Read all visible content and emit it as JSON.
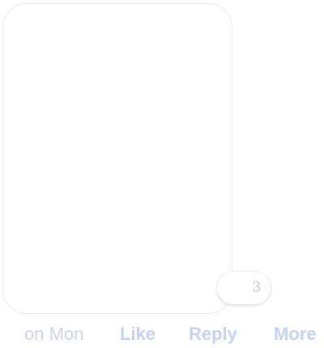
{
  "message": {
    "reactions": {
      "count": "3"
    }
  },
  "footer": {
    "timestamp": "on Mon",
    "actions": {
      "like": "Like",
      "reply": "Reply",
      "more": "More"
    }
  },
  "colors": {
    "bubble_border": "#e8ebee",
    "muted_text": "#cfd5e6",
    "action_text": "#c6d2ee"
  }
}
